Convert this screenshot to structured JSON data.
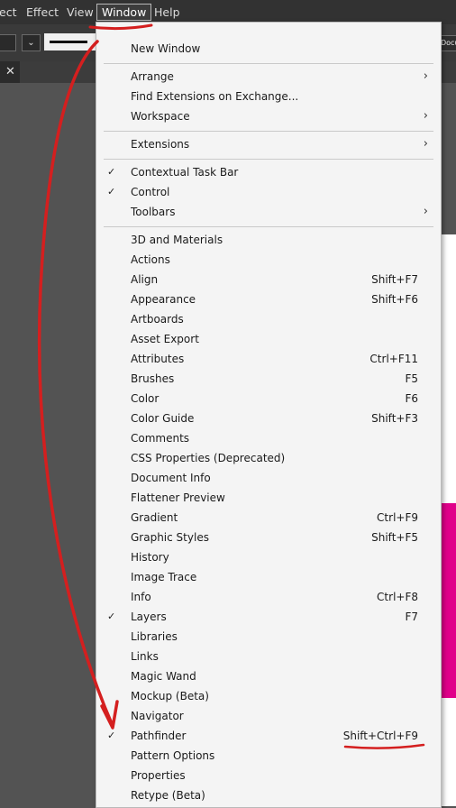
{
  "menubar": {
    "items": [
      {
        "label": "ect"
      },
      {
        "label": "Effect"
      },
      {
        "label": "View"
      },
      {
        "label": "Window"
      },
      {
        "label": "Help"
      }
    ]
  },
  "control_bar": {
    "stroke_glyph": "U",
    "doc_button": "Docu",
    "dropdown_glyph": "⌄"
  },
  "tab": {
    "close_glyph": "✕"
  },
  "window_menu": {
    "check_glyph": "✓",
    "submenu_glyph": "›",
    "items": [
      {
        "label": "New Window"
      },
      {
        "label": "Arrange",
        "submenu": true
      },
      {
        "label": "Find Extensions on Exchange..."
      },
      {
        "label": "Workspace",
        "submenu": true
      },
      {
        "label": "Extensions",
        "submenu": true
      },
      {
        "label": "Contextual Task Bar",
        "checked": true
      },
      {
        "label": "Control",
        "checked": true
      },
      {
        "label": "Toolbars",
        "submenu": true
      },
      {
        "label": "3D and Materials"
      },
      {
        "label": "Actions"
      },
      {
        "label": "Align",
        "shortcut": "Shift+F7"
      },
      {
        "label": "Appearance",
        "shortcut": "Shift+F6"
      },
      {
        "label": "Artboards"
      },
      {
        "label": "Asset Export"
      },
      {
        "label": "Attributes",
        "shortcut": "Ctrl+F11"
      },
      {
        "label": "Brushes",
        "shortcut": "F5"
      },
      {
        "label": "Color",
        "shortcut": "F6"
      },
      {
        "label": "Color Guide",
        "shortcut": "Shift+F3"
      },
      {
        "label": "Comments"
      },
      {
        "label": "CSS Properties (Deprecated)"
      },
      {
        "label": "Document Info"
      },
      {
        "label": "Flattener Preview"
      },
      {
        "label": "Gradient",
        "shortcut": "Ctrl+F9"
      },
      {
        "label": "Graphic Styles",
        "shortcut": "Shift+F5"
      },
      {
        "label": "History"
      },
      {
        "label": "Image Trace"
      },
      {
        "label": "Info",
        "shortcut": "Ctrl+F8"
      },
      {
        "label": "Layers",
        "shortcut": "F7",
        "checked": true
      },
      {
        "label": "Libraries"
      },
      {
        "label": "Links"
      },
      {
        "label": "Magic Wand"
      },
      {
        "label": "Mockup (Beta)"
      },
      {
        "label": "Navigator"
      },
      {
        "label": "Pathfinder",
        "shortcut": "Shift+Ctrl+F9",
        "checked": true
      },
      {
        "label": "Pattern Options"
      },
      {
        "label": "Properties"
      },
      {
        "label": "Retype (Beta)"
      }
    ]
  },
  "colors": {
    "annotation": "#d41f1f",
    "menu_bg": "#f4f4f4",
    "app_bg": "#535353",
    "artboard_accent": "#e0008a"
  }
}
